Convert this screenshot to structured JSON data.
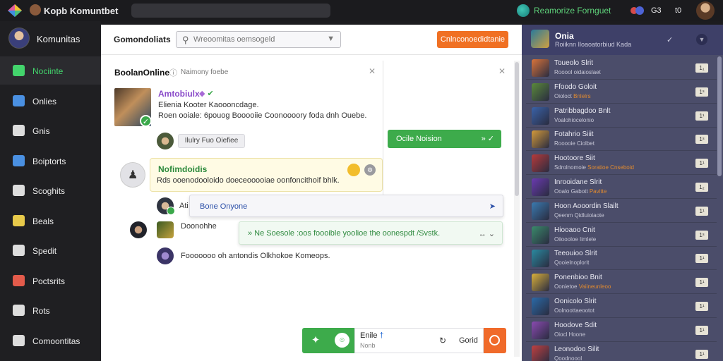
{
  "topbar": {
    "title": "Kopb Komuntbet",
    "status": "Reamorize Fornguet",
    "lang": "G3",
    "cc": "t0"
  },
  "sidebar": {
    "header": "Komunitas",
    "items": [
      {
        "label": "Nociinte",
        "icon": "grid-icon",
        "color": "#43d46c",
        "active": true
      },
      {
        "label": "Onlies",
        "icon": "people-icon",
        "color": "#4a90e2"
      },
      {
        "label": "Gnis",
        "icon": "window-icon",
        "color": "#dddddd"
      },
      {
        "label": "Boiptorts",
        "icon": "chat-bubble-icon",
        "color": "#4a90e2"
      },
      {
        "label": "Scoghits",
        "icon": "message-icon",
        "color": "#dddddd"
      },
      {
        "label": "Beals",
        "icon": "book-icon",
        "color": "#e7c94a"
      },
      {
        "label": "Spedit",
        "icon": "box-icon",
        "color": "#dddddd"
      },
      {
        "label": "Poctsrits",
        "icon": "trophy-icon",
        "color": "#e35b4b"
      },
      {
        "label": "Rots",
        "icon": "chat-icon",
        "color": "#dddddd"
      },
      {
        "label": "Comoontitas",
        "icon": "card-icon",
        "color": "#dddddd"
      }
    ]
  },
  "header": {
    "title": "Gomondoliats",
    "search_placeholder": "Wreoomitas oemsogeld",
    "action_label": "Cnlnconoedidtanie"
  },
  "chat": {
    "title": "BoolanOnline",
    "subtitle": "Naimony foebe",
    "post": {
      "name": "Amtobiulx",
      "sub": "Elienia  Kooter Kaoooncdage.",
      "text": "Roen ooiale: 6pouog Booooiie Coonoooory foda dnh Ouebe."
    },
    "chip": "Ilulry Fuo Oiefiee",
    "green_button": {
      "label": "Ocile Noision",
      "icon": "» ✓"
    },
    "highlight": {
      "name": "Nofimdoidis",
      "text": "Rds ooenodooloido doeceooooiae oonfoncithoif bhlk."
    },
    "row_a": {
      "text": "Ati",
      "float": "Bone Onyone"
    },
    "row_b": {
      "name": "Doonohhe",
      "float": "» Ne Soesole :oos foooible yoolioe the oonespdt /Svstk."
    },
    "row_c": {
      "text": "Fooooooo oh antondis Olkhokoe Komeops."
    },
    "composer": {
      "name": "Enile",
      "name_marker": "†",
      "sub": "Nonb",
      "send": "Gorid"
    }
  },
  "right_panel": {
    "header_title": "Onia",
    "header_sub": "Roiiknn  Iloaoatorbiud  Kada",
    "items": [
      {
        "title": "Toueolo Slrit",
        "sub": "Rooool oidaioslaet",
        "badge": "1₁",
        "accent": "#d9733a"
      },
      {
        "title": "Ffoodo Goloit",
        "sub": "Oioloct",
        "extra": "Bnlelrs",
        "badge": "1ˢ",
        "accent": "#5a8a3a"
      },
      {
        "title": "Patribbagdoo Bnlt",
        "sub": "Voalohiocelonio",
        "badge": "1¹",
        "accent": "#3a62a8"
      },
      {
        "title": "Fotahrio Siiit",
        "sub": "Rooooie Ciolbet",
        "badge": "1ˢ",
        "accent": "#d39a3a"
      },
      {
        "title": "Hootoore Siit",
        "sub": "Sdrolnomoie",
        "extra": "Soratioe Cnseboid",
        "badge": "1¹",
        "accent": "#b73a3a"
      },
      {
        "title": "Inrooidane Slrit",
        "sub": "Ooalo Gabott",
        "extra": "Pavitte",
        "badge": "1₂",
        "accent": "#6a3ab0"
      },
      {
        "title": "Hoon Aooordin Slailt",
        "sub": "Qeenm Qidluioiaote",
        "badge": "1¹",
        "accent": "#3a7ab0"
      },
      {
        "title": "Hiooaoo Cnit",
        "sub": "Oiioooloe Iimlele",
        "badge": "1ˢ",
        "accent": "#3a8a6a"
      },
      {
        "title": "Teeouioo Slrit",
        "sub": "Qooielnoplorit",
        "badge": "1¹",
        "accent": "#2a8aa0"
      },
      {
        "title": "Ponenbioo Bnit",
        "sub": "Oonietoe",
        "extra": "Vaiineunleoo",
        "badge": "1¹",
        "accent": "#d9b03a"
      },
      {
        "title": "Oonicolo Slrit",
        "sub": "Oolnoottaeootot",
        "badge": "1¹",
        "accent": "#2a6aa8"
      },
      {
        "title": "Hoodove Sdit",
        "sub": "Oiocl Hoone",
        "badge": "1¹",
        "accent": "#8a4ab0"
      },
      {
        "title": "Leonodoo Silit",
        "sub": "Qoodnoool",
        "badge": "1¹",
        "accent": "#c04040"
      }
    ]
  }
}
